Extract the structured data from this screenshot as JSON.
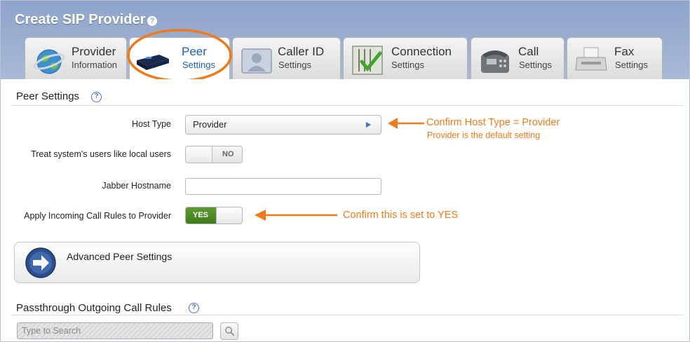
{
  "window": {
    "title": "Create SIP Provider",
    "help_glyph": "?"
  },
  "tabs": [
    {
      "line1": "Provider",
      "line2": "Information",
      "icon": "globe-icon",
      "active": false
    },
    {
      "line1": "Peer",
      "line2": "Settings",
      "icon": "device-icon",
      "active": true
    },
    {
      "line1": "Caller ID",
      "line2": "Settings",
      "icon": "person-id-icon",
      "active": false
    },
    {
      "line1": "Connection",
      "line2": "Settings",
      "icon": "connection-check-icon",
      "active": false
    },
    {
      "line1": "Call",
      "line2": "Settings",
      "icon": "phone-icon",
      "active": false
    },
    {
      "line1": "Fax",
      "line2": "Settings",
      "icon": "fax-icon",
      "active": false
    }
  ],
  "peer_settings": {
    "title": "Peer Settings",
    "help_glyph": "?",
    "host_type": {
      "label": "Host Type",
      "value": "Provider"
    },
    "treat_local": {
      "label": "Treat system's users like local users",
      "value": "NO"
    },
    "jabber": {
      "label": "Jabber Hostname",
      "value": ""
    },
    "incoming_rules": {
      "label": "Apply Incoming Call Rules to Provider",
      "value": "YES"
    }
  },
  "advanced": {
    "label": "Advanced Peer Settings"
  },
  "passthrough": {
    "title": "Passthrough Outgoing Call Rules",
    "help_glyph": "?",
    "search_placeholder": "Type to Search"
  },
  "annotations": {
    "host_line1": "Confirm Host Type = Provider",
    "host_line2": "Provider is the default setting",
    "yes_note": "Confirm this is set to YES"
  },
  "colors": {
    "accent_orange": "#f07a1a",
    "active_tab_text": "#1f5fae",
    "header_blue": "#8ea4cb",
    "toggle_green": "#4a8a25"
  }
}
